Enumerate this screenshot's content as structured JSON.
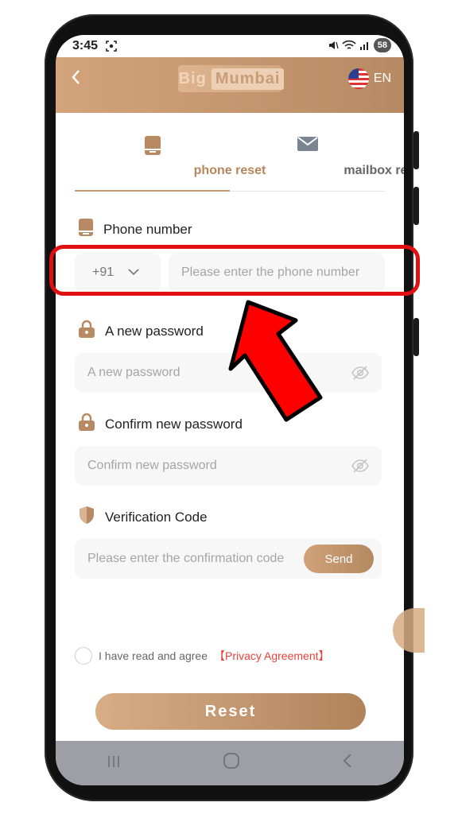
{
  "status_bar": {
    "time": "3:45",
    "battery": "58"
  },
  "header": {
    "logo_left": "Big",
    "logo_right": "Mumbai",
    "language": "EN"
  },
  "tabs": [
    {
      "label": "phone reset",
      "active": true,
      "icon": "phone-icon"
    },
    {
      "label": "mailbox reset",
      "active": false,
      "icon": "mail-icon"
    }
  ],
  "phone_section": {
    "label": "Phone number",
    "country_code": "+91",
    "placeholder": "Please enter the phone number"
  },
  "new_password": {
    "label": "A new password",
    "placeholder": "A new password"
  },
  "confirm_password": {
    "label": "Confirm new password",
    "placeholder": "Confirm new password"
  },
  "verification": {
    "label": "Verification Code",
    "placeholder": "Please enter the confirmation code",
    "send_label": "Send"
  },
  "agreement": {
    "text": "I have read and agree",
    "link": "【Privacy Agreement】"
  },
  "reset_label": "Reset",
  "colors": {
    "accent": "#c59a74",
    "link": "#e8423c",
    "annotation": "#e11010"
  }
}
